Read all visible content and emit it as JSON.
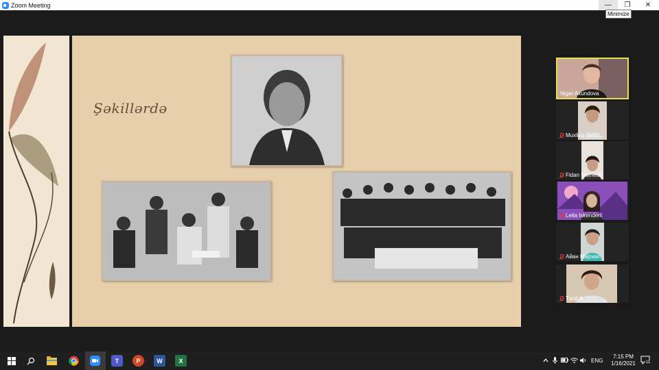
{
  "window": {
    "title": "Zoom Meeting",
    "tooltip": "Minimize",
    "minimize_glyph": "—",
    "maximize_glyph": "❐",
    "close_glyph": "✕"
  },
  "slide": {
    "heading": "Şəkillərdə"
  },
  "participants": [
    {
      "name": "Nigar Axundova",
      "muted": false,
      "active": true
    },
    {
      "name": "Muxlisa Seidz...",
      "muted": true,
      "active": false
    },
    {
      "name": "Fidan Mamedli",
      "muted": true,
      "active": false
    },
    {
      "name": "Leila Iskenderli",
      "muted": true,
      "active": false
    },
    {
      "name": "Айан Мирзаи",
      "muted": true,
      "active": false
    },
    {
      "name": "Tural A",
      "muted": true,
      "active": false
    }
  ],
  "taskbar": {
    "apps": [
      {
        "name": "windows-start-icon"
      },
      {
        "name": "search-icon"
      },
      {
        "name": "file-explorer-icon"
      },
      {
        "name": "chrome-icon"
      },
      {
        "name": "zoom-icon"
      },
      {
        "name": "teams-icon",
        "label": "T"
      },
      {
        "name": "powerpoint-icon",
        "label": "P"
      },
      {
        "name": "word-icon",
        "label": "W"
      },
      {
        "name": "excel-icon",
        "label": "X"
      }
    ],
    "language": "ENG",
    "time": "7:15 PM",
    "date": "1/16/2021",
    "notification_count": "11",
    "colors": {
      "zoom": "#2d8cff",
      "chrome": "#db4437",
      "teams": "#5059c9",
      "powerpoint": "#d24726",
      "word": "#2b579a",
      "excel": "#217346",
      "explorer": "#f4c542"
    }
  }
}
